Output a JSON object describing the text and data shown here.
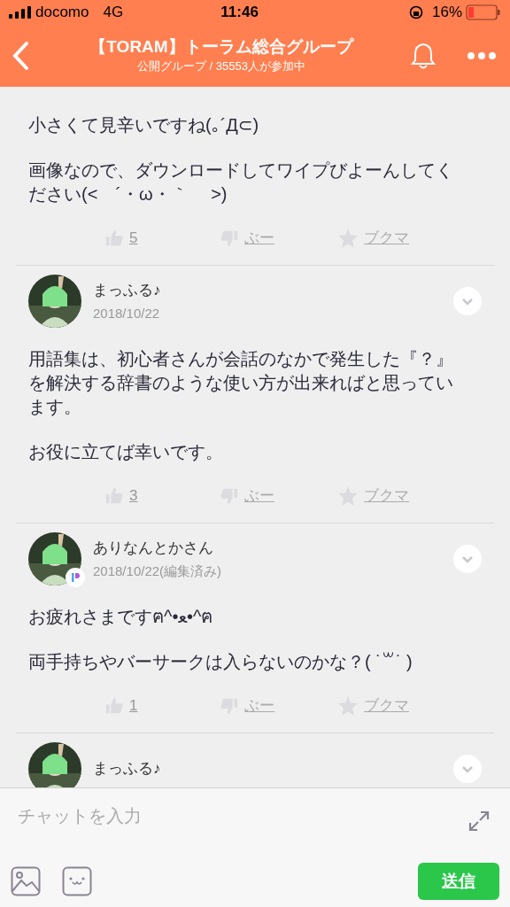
{
  "status_bar": {
    "carrier": "docomo",
    "network": "4G",
    "time": "11:46",
    "battery": "16%"
  },
  "header": {
    "title": "【TORAM】トーラム総合グループ",
    "subtitle": "公開グループ / 35553人が参加中"
  },
  "posts": [
    {
      "body": [
        "小さくて見辛いですね(｡´Д⊂)",
        "画像なので、ダウンロードしてワイプびよーんしてください(<　´・ω・｀　 >)"
      ],
      "likes": "5",
      "dislike": "ぶー",
      "bookmark": "ブクマ"
    },
    {
      "author": "まっふる♪",
      "date": "2018/10/22",
      "badge": false,
      "body": [
        "用語集は、初心者さんが会話のなかで発生した『？』を解決する辞書のような使い方が出来ればと思っています。",
        "お役に立てば幸いです。"
      ],
      "likes": "3",
      "dislike": "ぶー",
      "bookmark": "ブクマ"
    },
    {
      "author": "ありなんとかさん",
      "date": "2018/10/22(編集済み)",
      "badge": true,
      "body": [
        "お疲れさまですฅ^•ﻌ•^ฅ",
        "両手持ちやバーサークは入らないのかな？( ˙꒳˙ )"
      ],
      "likes": "1",
      "dislike": "ぶー",
      "bookmark": "ブクマ"
    },
    {
      "author": "まっふる♪",
      "badge": false
    }
  ],
  "composer": {
    "placeholder": "チャットを入力",
    "send": "送信"
  }
}
